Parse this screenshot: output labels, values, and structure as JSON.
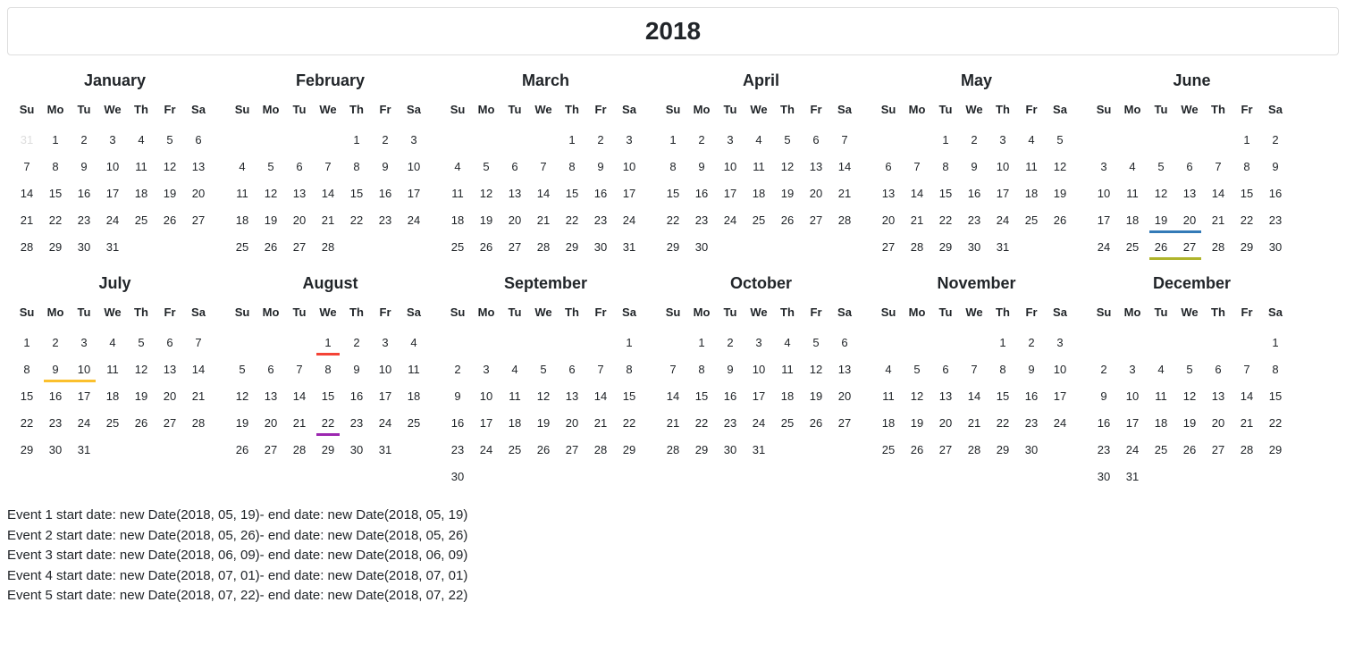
{
  "year": "2018",
  "daysOfWeek": [
    "Su",
    "Mo",
    "Tu",
    "We",
    "Th",
    "Fr",
    "Sa"
  ],
  "months": [
    {
      "name": "January",
      "start": 1,
      "days": 31,
      "prev": 31,
      "muteFirst": true
    },
    {
      "name": "February",
      "start": 4,
      "days": 28,
      "prev": 31
    },
    {
      "name": "March",
      "start": 4,
      "days": 31,
      "prev": 28
    },
    {
      "name": "April",
      "start": 0,
      "days": 30,
      "prev": 31
    },
    {
      "name": "May",
      "start": 2,
      "days": 31,
      "prev": 30
    },
    {
      "name": "June",
      "start": 5,
      "days": 30,
      "prev": 31
    },
    {
      "name": "July",
      "start": 0,
      "days": 31,
      "prev": 30
    },
    {
      "name": "August",
      "start": 3,
      "days": 31,
      "prev": 31
    },
    {
      "name": "September",
      "start": 6,
      "days": 30,
      "prev": 31
    },
    {
      "name": "October",
      "start": 1,
      "days": 31,
      "prev": 30
    },
    {
      "name": "November",
      "start": 4,
      "days": 30,
      "prev": 31
    },
    {
      "name": "December",
      "start": 6,
      "days": 31,
      "prev": 30
    }
  ],
  "highlights": [
    {
      "month": 5,
      "day": 19,
      "span": 2,
      "color": "#337ab7"
    },
    {
      "month": 5,
      "day": 26,
      "span": 2,
      "color": "#afb42b"
    },
    {
      "month": 6,
      "day": 9,
      "span": 2,
      "color": "#fbc02d"
    },
    {
      "month": 7,
      "day": 1,
      "span": 1,
      "color": "#f44336"
    },
    {
      "month": 7,
      "day": 22,
      "span": 1,
      "color": "#9c27b0"
    }
  ],
  "events": [
    "Event 1 start date: new Date(2018, 05, 19)- end date: new Date(2018, 05, 19)",
    "Event 2 start date: new Date(2018, 05, 26)- end date: new Date(2018, 05, 26)",
    "Event 3 start date: new Date(2018, 06, 09)- end date: new Date(2018, 06, 09)",
    "Event 4 start date: new Date(2018, 07, 01)- end date: new Date(2018, 07, 01)",
    "Event 5 start date: new Date(2018, 07, 22)- end date: new Date(2018, 07, 22)"
  ]
}
